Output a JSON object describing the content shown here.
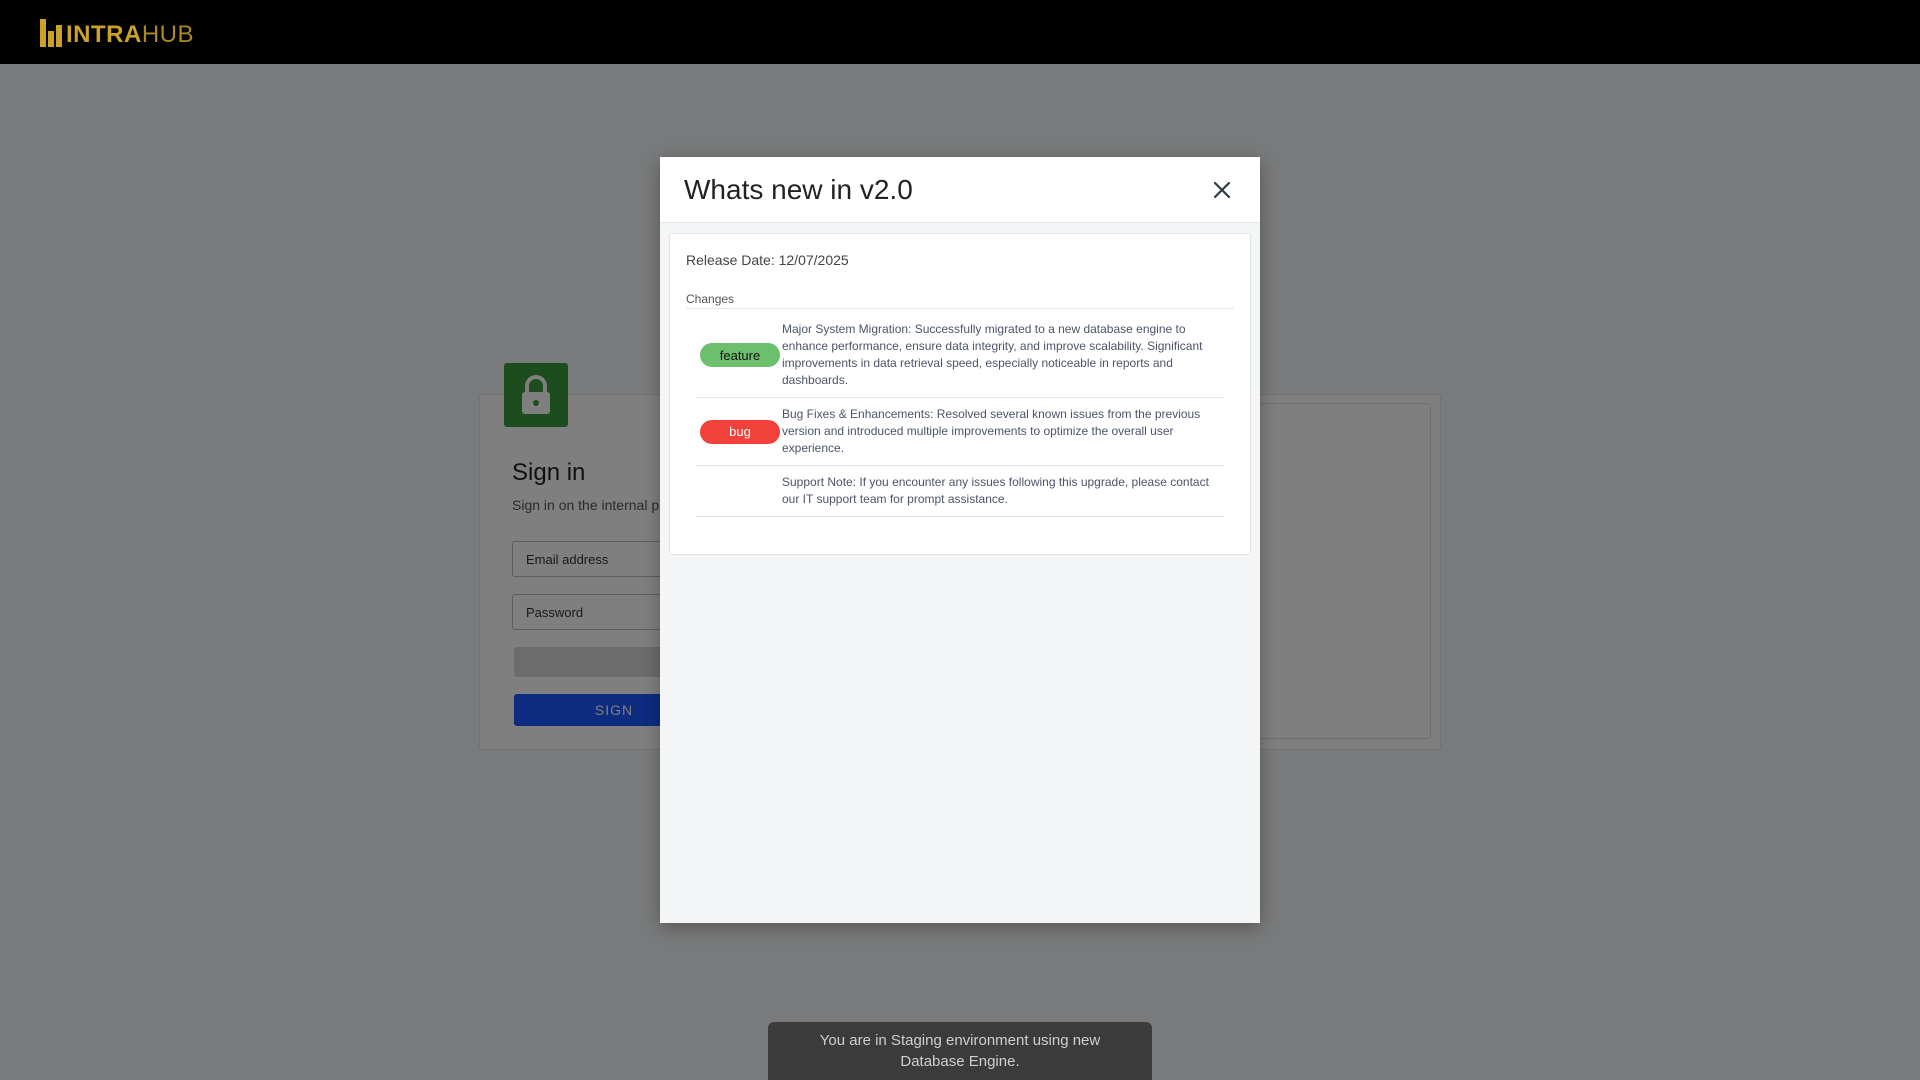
{
  "brand": {
    "logo_part1": "INTRA",
    "logo_part2": "HUB",
    "accent": "#c9a227"
  },
  "signin": {
    "title": "Sign in",
    "subtitle": "Sign in on the internal pl",
    "email_placeholder": "Email address",
    "password_placeholder": "Password",
    "submit_label": "SIGN",
    "lock_icon": "lock-icon"
  },
  "modal": {
    "title": "Whats new in v2.0",
    "close_icon": "close-icon",
    "release_date": "Release Date: 12/07/2025",
    "changes_heading": "Changes",
    "changes": [
      {
        "type": "feature",
        "badge": "feature",
        "color": "#6cc06d",
        "text": "Major System Migration: Successfully migrated to a new database engine to enhance performance, ensure data integrity, and improve scalability. Significant improvements in data retrieval speed, especially noticeable in reports and dashboards."
      },
      {
        "type": "bug",
        "badge": "bug",
        "color": "#f2403a",
        "text": "Bug Fixes & Enhancements: Resolved several known issues from the previous version and introduced multiple improvements to optimize the overall user experience."
      },
      {
        "type": "",
        "badge": "",
        "text": "Support Note: If you encounter any issues following this upgrade, please contact our IT support team for prompt assistance."
      }
    ]
  },
  "toast": {
    "text": "You are in Staging environment using new Database Engine."
  }
}
